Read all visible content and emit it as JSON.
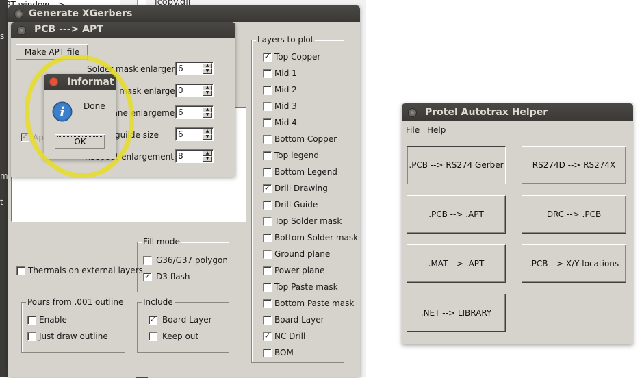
{
  "desktop": {
    "file_label": "icopy.dll",
    "left_fragments": [
      "s",
      "m",
      "t"
    ]
  },
  "xgerbers": {
    "title": "Generate XGerbers",
    "layers": {
      "group_label": "Layers to plot",
      "items": [
        {
          "label": "Top Copper",
          "checked": true
        },
        {
          "label": "Mid 1",
          "checked": false
        },
        {
          "label": "Mid 2",
          "checked": false
        },
        {
          "label": "Mid 3",
          "checked": false
        },
        {
          "label": "Mid 4",
          "checked": false
        },
        {
          "label": "Bottom Copper",
          "checked": false
        },
        {
          "label": "Top legend",
          "checked": false
        },
        {
          "label": "Bottom Legend",
          "checked": false
        },
        {
          "label": "Drill Drawing",
          "checked": true
        },
        {
          "label": "Drill Guide",
          "checked": false
        },
        {
          "label": "Top Solder mask",
          "checked": false
        },
        {
          "label": "Bottom Solder mask",
          "checked": false
        },
        {
          "label": "Ground plane",
          "checked": false
        },
        {
          "label": "Power plane",
          "checked": false
        },
        {
          "label": "Top Paste mask",
          "checked": false
        },
        {
          "label": "Bottom Paste mask",
          "checked": false
        },
        {
          "label": "Board Layer",
          "checked": false
        },
        {
          "label": "NC Drill",
          "checked": true
        },
        {
          "label": "BOM",
          "checked": false
        }
      ]
    },
    "fill_mode": {
      "group_label": "Fill mode",
      "items": [
        {
          "label": "G36/G37 polygon",
          "checked": false
        },
        {
          "label": "D3 flash",
          "checked": true
        }
      ]
    },
    "thermals": {
      "label": "Thermals on external layers",
      "checked": false
    },
    "pours": {
      "group_label": "Pours from .001 outline",
      "items": [
        {
          "label": "Enable",
          "checked": false
        },
        {
          "label": "Just draw outline",
          "checked": false
        }
      ]
    },
    "include": {
      "group_label": "Include",
      "items": [
        {
          "label": "Board Layer",
          "checked": true
        },
        {
          "label": "Keep out",
          "checked": false
        }
      ]
    }
  },
  "pcb_apt": {
    "title": "PCB ---> APT",
    "make_button": "Make APT file",
    "fields": [
      {
        "label": "Solder mask enlargement",
        "value": "6"
      },
      {
        "label": "Paste mask enlargement",
        "value": "0"
      },
      {
        "label": "Plane enlargement",
        "value": "6"
      },
      {
        "label": "Drill guilde size",
        "value": "6"
      },
      {
        "label": "Keepout enlargement",
        "value": "8"
      }
    ],
    "aperture_checkbox": {
      "label": "Ape",
      "checked": true
    }
  },
  "info_dialog": {
    "title": "Informat",
    "message": "Done",
    "ok_label": "OK"
  },
  "helper": {
    "title": "Protel Autotrax Helper",
    "menu": [
      {
        "label": "File",
        "underline": "F",
        "rest": "ile"
      },
      {
        "label": "Help",
        "underline": "H",
        "rest": "elp"
      }
    ],
    "buttons": [
      ".PCB --> RS274 Gerber",
      "RS274D --> RS274X",
      ".PCB --> .APT",
      "DRC --> .PCB",
      ".MAT --> .APT",
      ".PCB --> X/Y locations",
      ".NET --> LIBRARY"
    ]
  },
  "colors": {
    "window_bg": "#d6d3cc",
    "titlebar": "#3c3b37",
    "close_button": "#e2533a",
    "info_icon": "#2f6fb5",
    "highlight": "#e6dc28"
  }
}
